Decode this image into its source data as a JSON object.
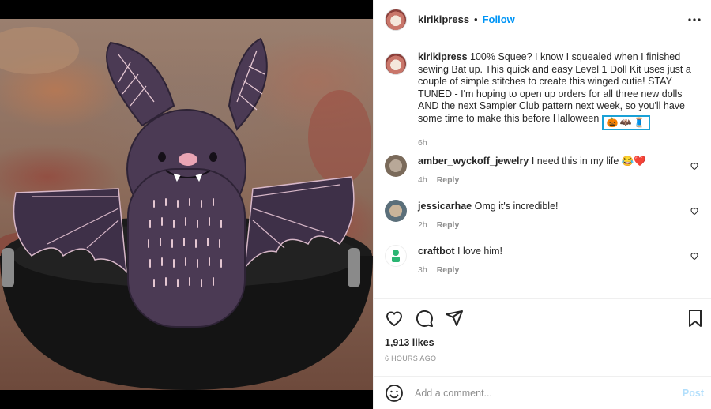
{
  "post": {
    "username": "kirikipress",
    "separator": "•",
    "follow_label": "Follow",
    "more_icon": "more-horizontal-icon"
  },
  "caption": {
    "username": "kirikipress",
    "text": "100% Squee? I know I squealed when I finished sewing Bat up. This quick and easy Level 1 Doll Kit uses just a couple of simple stitches to create this winged cutie! STAY TUNED - I'm hoping to open up orders for all three new dolls AND the next Sampler Club pattern next week, so you'll have some time to make this before Halloween",
    "emojis": [
      "🎃",
      "🦇",
      "🧵"
    ],
    "time": "6h",
    "highlight_color": "#1aa1d6"
  },
  "comments": [
    {
      "username": "amber_wyckoff_jewelry",
      "text": "I need this in my life",
      "emojis": "😂❤️",
      "time": "4h",
      "reply": "Reply",
      "avatar_color": "#7a6a5a"
    },
    {
      "username": "jessicarhae",
      "text": "Omg it's incredible!",
      "emojis": "",
      "time": "2h",
      "reply": "Reply",
      "avatar_color": "#5b6f7a"
    },
    {
      "username": "craftbot",
      "text": "I love him!",
      "emojis": "",
      "time": "3h",
      "reply": "Reply",
      "avatar_color": "#2bb673"
    }
  ],
  "actions": {
    "like_icon": "heart-icon",
    "comment_icon": "comment-icon",
    "share_icon": "share-icon",
    "save_icon": "bookmark-icon"
  },
  "likes": "1,913 likes",
  "posted_ago": "6 HOURS AGO",
  "add_comment": {
    "placeholder": "Add a comment...",
    "post_label": "Post"
  },
  "colors": {
    "link": "#0095f6",
    "post_disabled": "#b2dffc",
    "muted": "#8e8e8e",
    "doll_fabric": "#4b3a54"
  }
}
